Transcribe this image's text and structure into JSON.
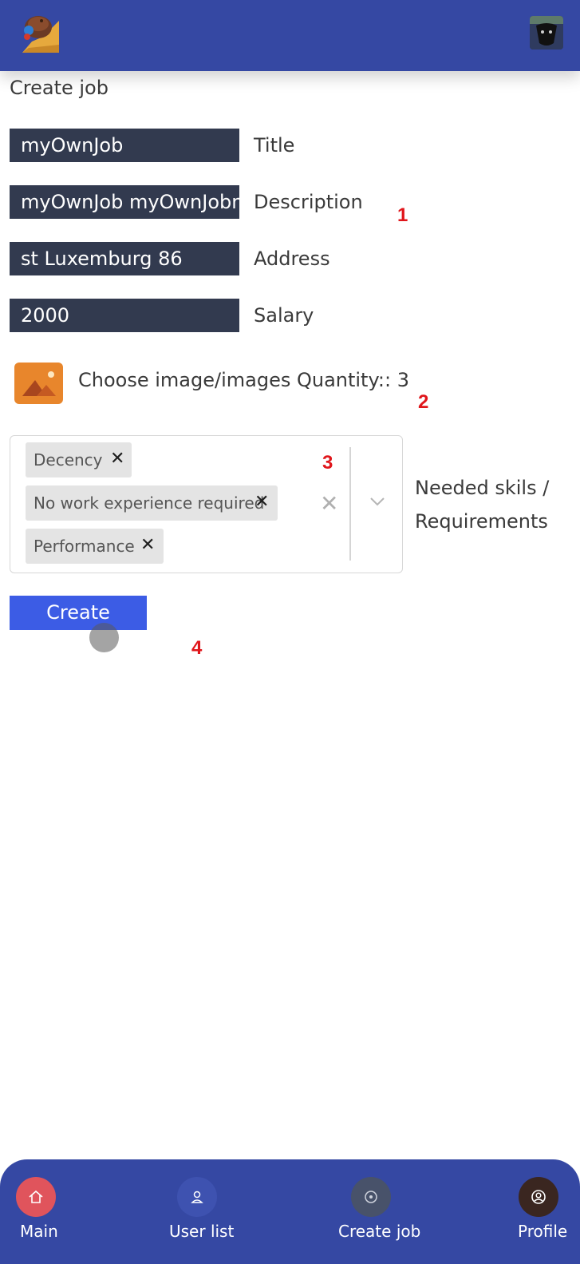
{
  "header": {
    "logo_icon": "armadillo-logo-icon",
    "avatar_icon": "user-avatar-icon",
    "page_title": "Create job"
  },
  "form": {
    "fields": [
      {
        "value": "myOwnJob",
        "label": "Title"
      },
      {
        "value": "myOwnJob myOwnJobm",
        "label": "Description"
      },
      {
        "value": "st Luxemburg 86",
        "label": "Address"
      },
      {
        "value": "2000",
        "label": "Salary"
      }
    ],
    "image_picker": {
      "icon": "image-icon",
      "label": "Choose image/images  Quantity:: 3"
    },
    "skills": {
      "selected": [
        "Decency",
        "No work experience required",
        "Performance"
      ],
      "label_line1": "Needed skils /",
      "label_line2": "Requirements"
    },
    "create_label": "Create"
  },
  "annotations": [
    "1",
    "2",
    "3",
    "4"
  ],
  "bottom_nav": {
    "items": [
      {
        "label": "Main",
        "icon": "home-icon",
        "color": "#e0545c"
      },
      {
        "label": "User list",
        "icon": "user-icon",
        "color": "#3e52b0"
      },
      {
        "label": "Create job",
        "icon": "create-job-icon",
        "color": "#48526a"
      },
      {
        "label": "Profile",
        "icon": "profile-icon",
        "color": "#3a2620"
      }
    ]
  },
  "colors": {
    "primary": "#3548a3",
    "input_bg": "#323a4f",
    "button": "#3c5ce5",
    "annotation": "#e0161b"
  }
}
